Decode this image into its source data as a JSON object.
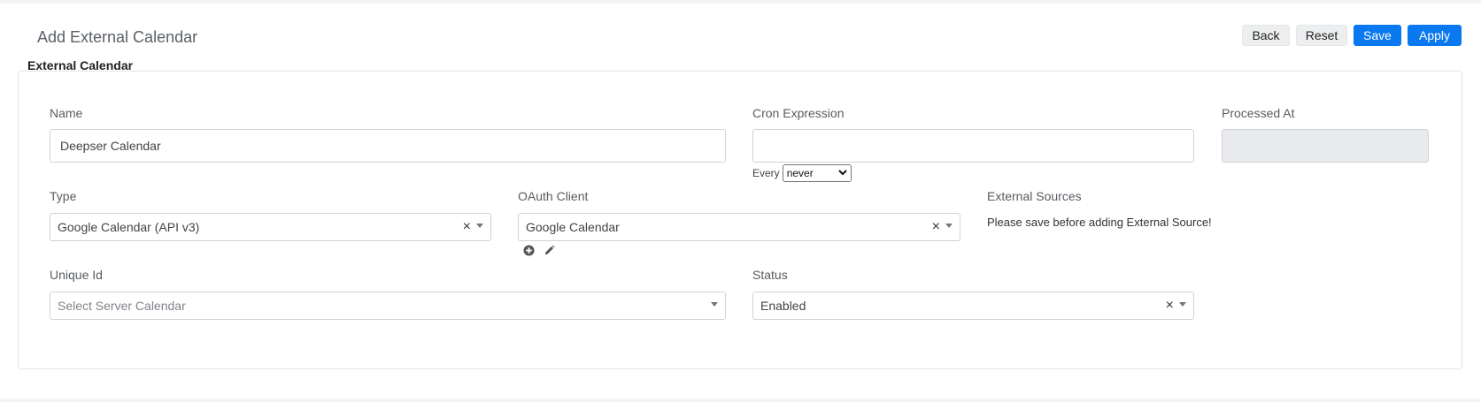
{
  "header": {
    "title": "Add External Calendar"
  },
  "toolbar": {
    "back": "Back",
    "reset": "Reset",
    "save": "Save",
    "apply": "Apply"
  },
  "section": {
    "label": "External Calendar"
  },
  "fields": {
    "name": {
      "label": "Name",
      "value": "Deepser Calendar"
    },
    "cron": {
      "label": "Cron Expression",
      "value": "",
      "every_label": "Every",
      "every_value": "never"
    },
    "processed_at": {
      "label": "Processed At",
      "value": ""
    },
    "type": {
      "label": "Type",
      "value": "Google Calendar (API v3)"
    },
    "oauth_client": {
      "label": "OAuth Client",
      "value": "Google Calendar"
    },
    "external_sources": {
      "label": "External Sources",
      "note": "Please save before adding External Source!"
    },
    "unique_id": {
      "label": "Unique Id",
      "placeholder": "Select Server Calendar"
    },
    "status": {
      "label": "Status",
      "value": "Enabled"
    }
  },
  "icons": {
    "add": "plus-circle-icon",
    "edit": "pencil-icon",
    "clear": "×",
    "dropdown": "caret-down-icon"
  },
  "colors": {
    "primary": "#0a78ee",
    "light_button": "#eceef0",
    "disabled_field": "#e8eaed"
  }
}
